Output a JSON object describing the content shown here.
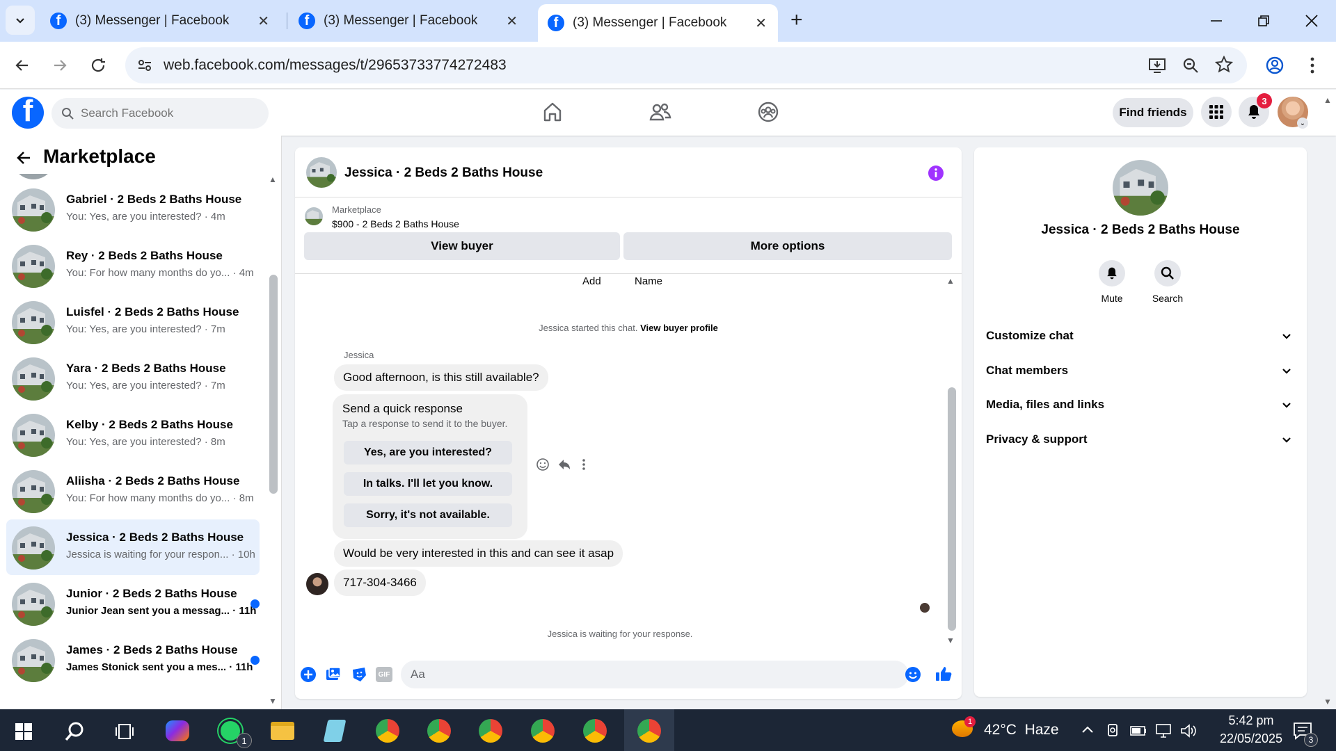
{
  "browser": {
    "tabs": [
      {
        "title": "(3) Messenger | Facebook"
      },
      {
        "title": "(3) Messenger | Facebook"
      },
      {
        "title": "(3) Messenger | Facebook"
      }
    ],
    "url": "web.facebook.com/messages/t/29653733774272483"
  },
  "fb_header": {
    "search_placeholder": "Search Facebook",
    "find_friends": "Find friends",
    "notification_count": "3"
  },
  "left_pane": {
    "title": "Marketplace",
    "conversations": [
      {
        "title": "Gabriel · 2 Beds 2 Baths House",
        "snippet": "You: Yes, are you interested? · 4m",
        "unread": false,
        "selected": false
      },
      {
        "title": "Rey · 2 Beds 2 Baths House",
        "snippet": "You: For how many months do yo... · 4m",
        "unread": false,
        "selected": false
      },
      {
        "title": "Luisfel · 2 Beds 2 Baths House",
        "snippet": "You: Yes, are you interested? · 7m",
        "unread": false,
        "selected": false
      },
      {
        "title": "Yara · 2 Beds 2 Baths House",
        "snippet": "You: Yes, are you interested? · 7m",
        "unread": false,
        "selected": false
      },
      {
        "title": "Kelby · 2 Beds 2 Baths House",
        "snippet": "You: Yes, are you interested? · 8m",
        "unread": false,
        "selected": false
      },
      {
        "title": "Aliisha · 2 Beds 2 Baths House",
        "snippet": "You: For how many months do yo... · 8m",
        "unread": false,
        "selected": false
      },
      {
        "title": "Jessica · 2 Beds 2 Baths House",
        "snippet": "Jessica is waiting for your respon... · 10h",
        "unread": false,
        "selected": true
      },
      {
        "title": "Junior · 2 Beds 2 Baths House",
        "snippet": "Junior Jean sent you a messag... · 11h",
        "unread": true,
        "selected": false
      },
      {
        "title": "James · 2 Beds 2 Baths House",
        "snippet": "James Stonick sent you a mes... · 11h",
        "unread": true,
        "selected": false
      }
    ]
  },
  "chat": {
    "name": "Jessica · 2 Beds 2 Baths House",
    "listing_label": "Marketplace",
    "listing_title": "$900 - 2 Beds 2 Baths House",
    "view_buyer": "View buyer",
    "more_options": "More options",
    "add_label": "Add",
    "name_label": "Name",
    "started_text": "Jessica started this chat.",
    "view_buyer_profile": "View buyer profile",
    "sender": "Jessica",
    "msg1": "Good afternoon, is this still available?",
    "quick_title": "Send a quick response",
    "quick_sub": "Tap a response to send it to the buyer.",
    "quick_options": [
      "Yes, are you interested?",
      "In talks. I'll let you know.",
      "Sorry, it's not available."
    ],
    "msg2": "Would be very interested in this and can see it asap",
    "msg3": "717-304-3466",
    "waiting": "Jessica is waiting for your response.",
    "composer_placeholder": "Aa"
  },
  "right_pane": {
    "name": "Jessica · 2 Beds 2 Baths House",
    "mute": "Mute",
    "search": "Search",
    "sections": [
      "Customize chat",
      "Chat members",
      "Media, files and links",
      "Privacy & support"
    ]
  },
  "taskbar": {
    "weather": "42°C  Haze",
    "weather_badge": "1",
    "whatsapp_badge": "1",
    "time": "5:42 pm",
    "date": "22/05/2025",
    "notif_count": "3"
  }
}
